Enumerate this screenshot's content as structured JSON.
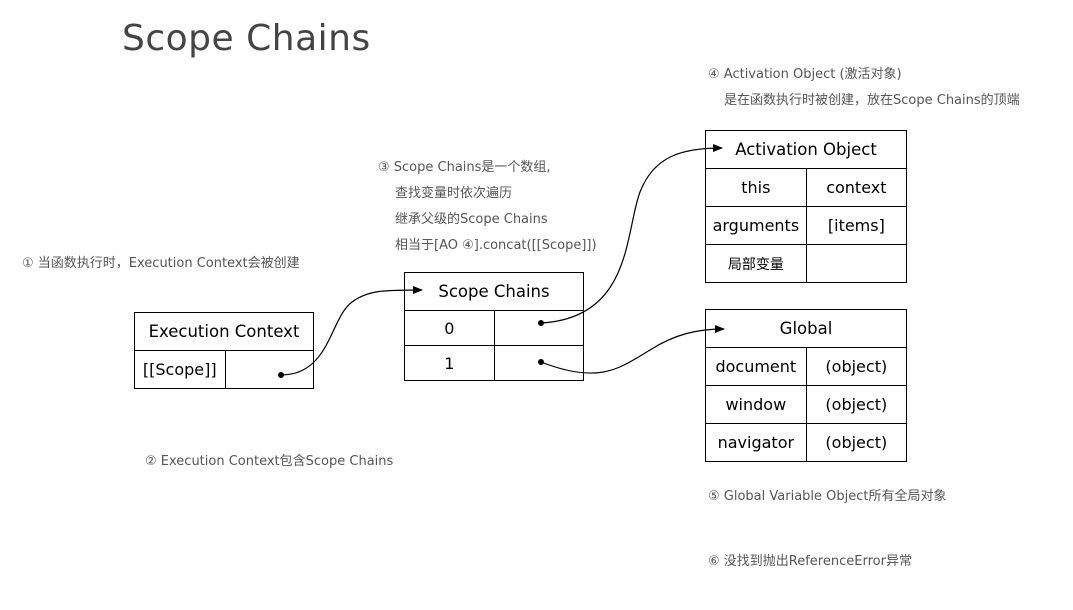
{
  "title": "Scope Chains",
  "notes": {
    "n1": "① 当函数执行时，Execution Context会被创建",
    "n2": "② Execution Context包含Scope Chains",
    "n3": [
      "③ Scope Chains是一个数组,",
      "查找变量时依次遍历",
      "继承父级的Scope Chains",
      "相当于[AO ④].concat([[Scope]])"
    ],
    "n4": [
      "④ Activation Object (激活对象)",
      "是在函数执行时被创建，放在Scope Chains的顶端"
    ],
    "n5": "⑤ Global Variable Object所有全局对象",
    "n6": "⑥ 没找到抛出ReferenceError异常"
  },
  "execution_context": {
    "header": "Execution Context",
    "rows": [
      [
        "[[Scope]]",
        ""
      ]
    ]
  },
  "scope_chains": {
    "header": "Scope Chains",
    "rows": [
      [
        "0",
        ""
      ],
      [
        "1",
        ""
      ]
    ]
  },
  "activation_object": {
    "header": "Activation Object",
    "rows": [
      [
        "this",
        "context"
      ],
      [
        "arguments",
        "[items]"
      ],
      [
        "局部变量",
        ""
      ]
    ]
  },
  "global": {
    "header": "Global",
    "rows": [
      [
        "document",
        "(object)"
      ],
      [
        "window",
        "(object)"
      ],
      [
        "navigator",
        "(object)"
      ]
    ]
  },
  "colors": {
    "text": "#000000",
    "note": "#555555",
    "title": "#444444"
  }
}
